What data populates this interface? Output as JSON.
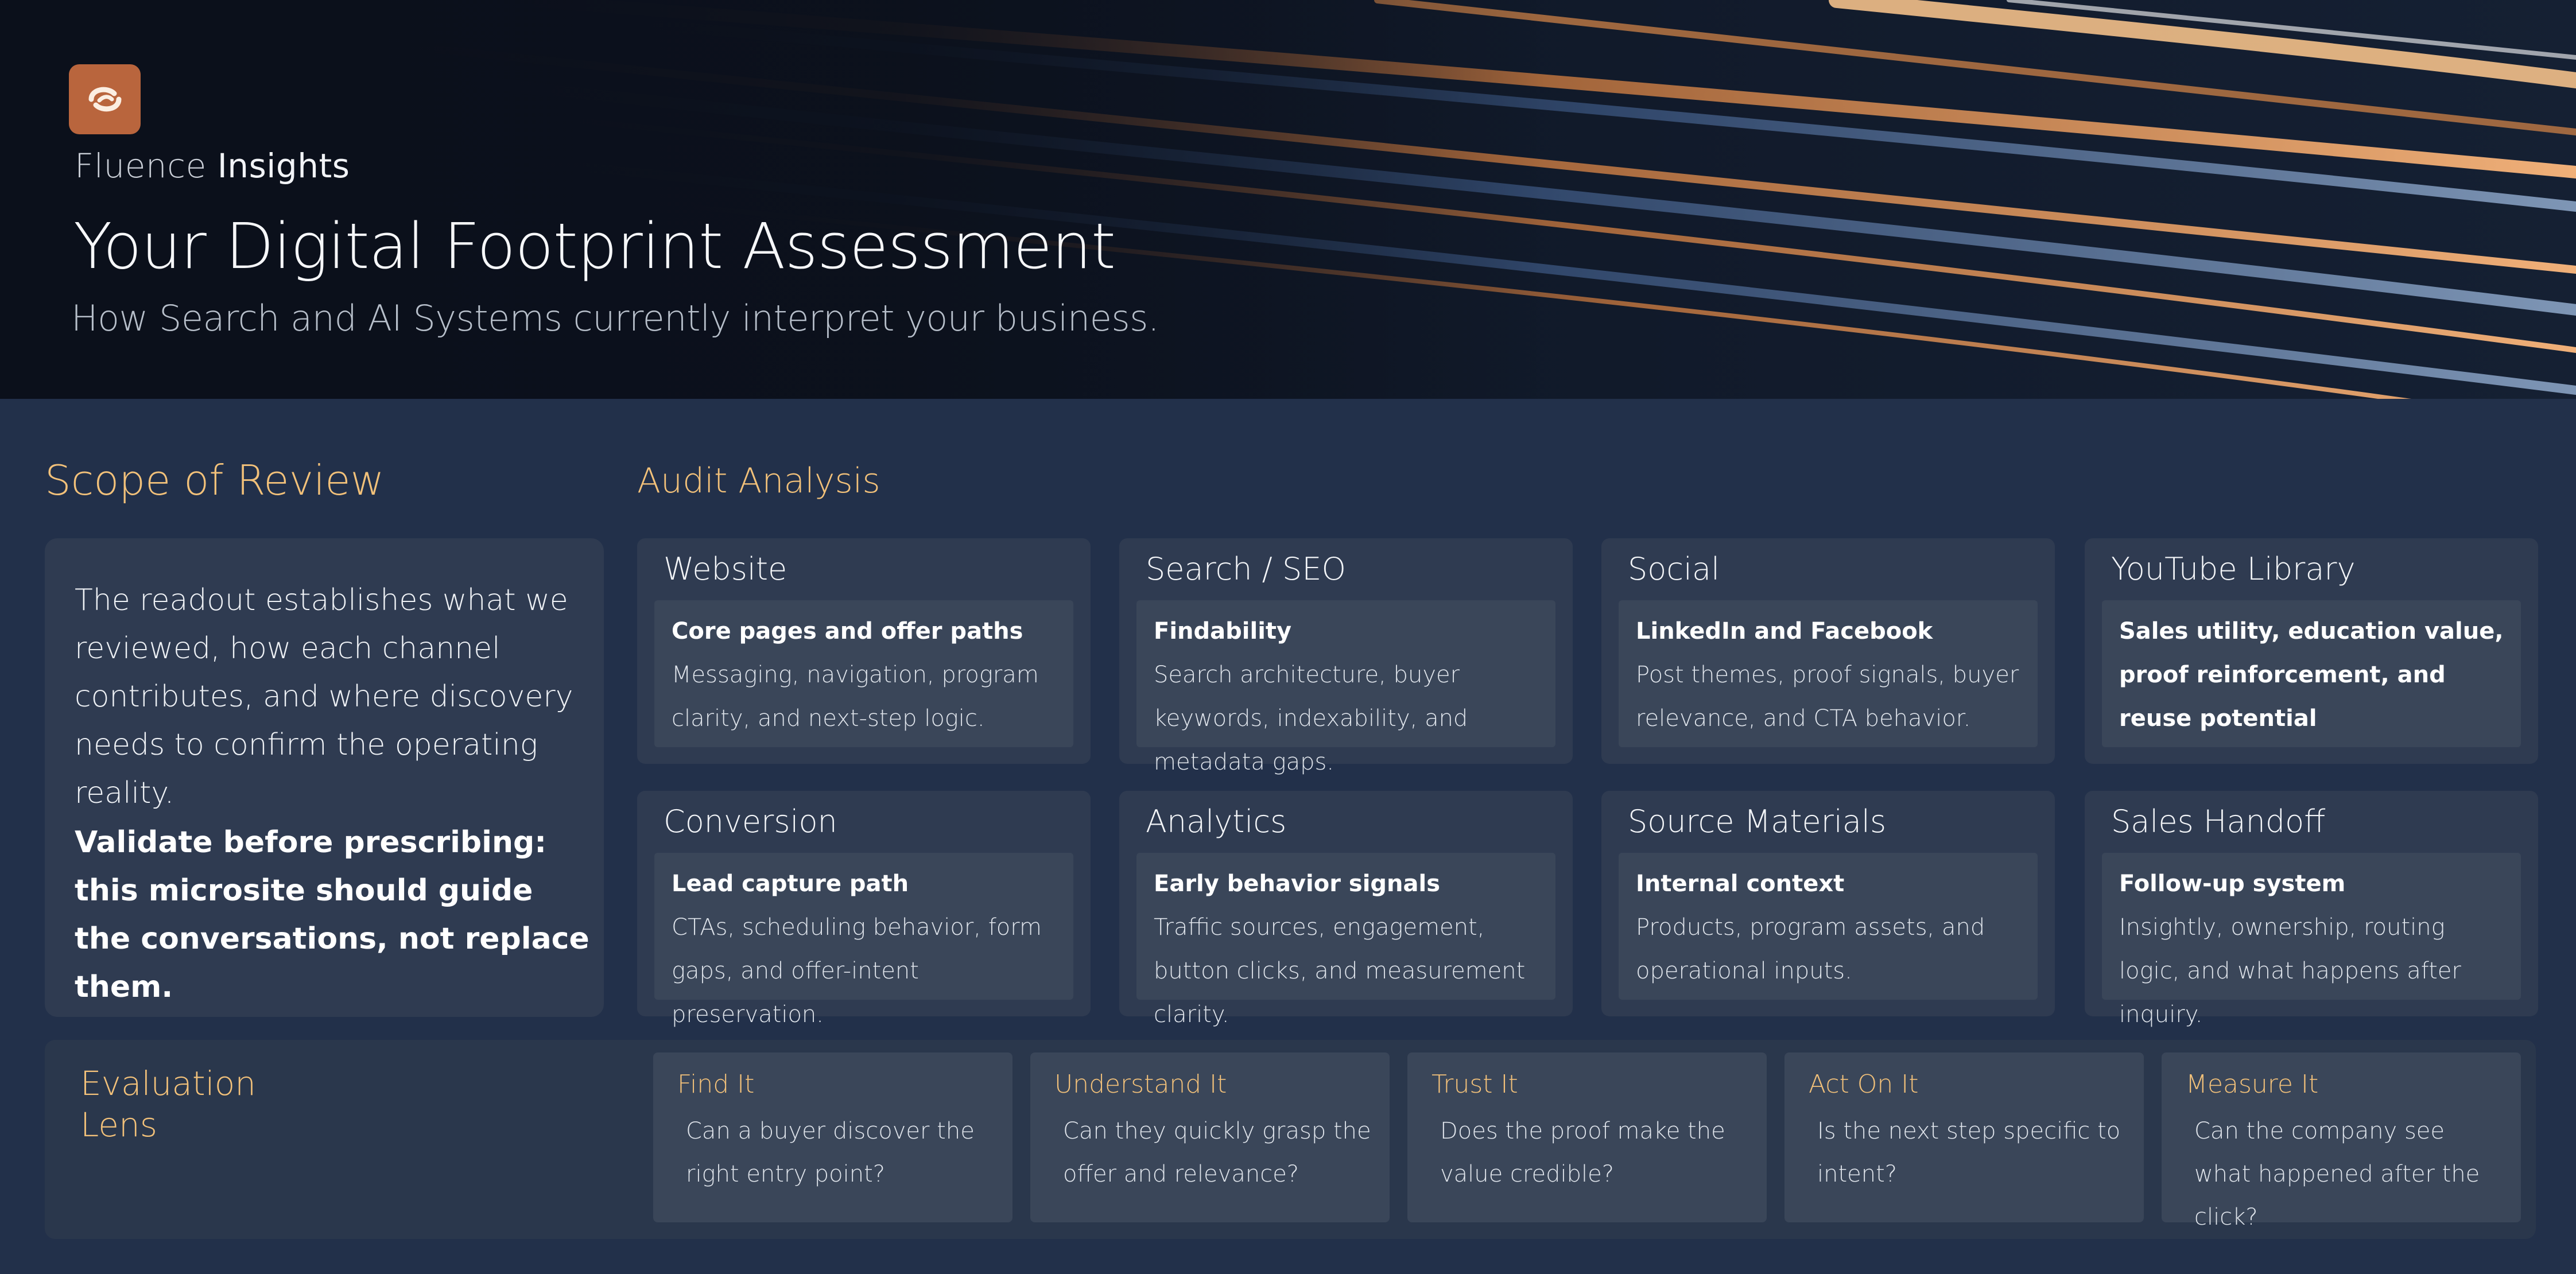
{
  "hero": {
    "brand_light": "Fluence",
    "brand_strong": "Insights",
    "title": "Your Digital Footprint Assessment",
    "subtitle": "How Search and AI Systems currently interpret your business."
  },
  "scope": {
    "title": "Scope of Review",
    "body": "The readout establishes what we reviewed, how each channel contributes, and where discovery needs to confirm the operating reality.",
    "emphasis": "Validate before prescribing: this microsite should guide the conversations, not replace them."
  },
  "audit": {
    "title": "Audit Analysis",
    "cards": [
      {
        "title": "Website",
        "head": "Core pages and offer paths",
        "body": "Messaging, navigation, program clarity, and next-step logic."
      },
      {
        "title": "Search / SEO",
        "head": "Findability",
        "body": "Search architecture, buyer keywords, indexability, and metadata gaps."
      },
      {
        "title": "Social",
        "head": "LinkedIn and Facebook",
        "body": "Post themes, proof signals, buyer relevance, and CTA behavior."
      },
      {
        "title": "YouTube Library",
        "head": "Sales utility, education value, proof reinforcement, and reuse potential",
        "body": ""
      },
      {
        "title": "Conversion",
        "head": "Lead capture path",
        "body": "CTAs, scheduling behavior, form gaps, and offer-intent preservation."
      },
      {
        "title": "Analytics",
        "head": "Early behavior signals",
        "body": "Traffic sources, engagement, button clicks, and measurement clarity."
      },
      {
        "title": "Source Materials",
        "head": "Internal context",
        "body": "Products, program assets, and operational inputs."
      },
      {
        "title": "Sales Handoff",
        "head": "Follow-up system",
        "body": "Insightly, ownership, routing logic, and what happens after inquiry."
      }
    ]
  },
  "lens": {
    "title_line1": "Evaluation",
    "title_line2": "Lens",
    "items": [
      {
        "name": "Find It",
        "question": "Can a buyer discover the right entry point?"
      },
      {
        "name": "Understand  It",
        "question": "Can they quickly grasp the offer and relevance?"
      },
      {
        "name": "Trust It",
        "question": "Does the proof make the value credible?"
      },
      {
        "name": "Act On  It",
        "question": "Is the next step specific to intent?"
      },
      {
        "name": "Measure  It",
        "question": "Can the company see what happened after the click?"
      }
    ]
  },
  "colors": {
    "accent_gold": "#f2c17a",
    "logo_copper": "#b9653d",
    "page_bg": "#22304a",
    "card_bg": "#2f3b51",
    "inner_bg": "#3a4659"
  },
  "icons": {
    "logo": "fluence-logo-icon"
  }
}
